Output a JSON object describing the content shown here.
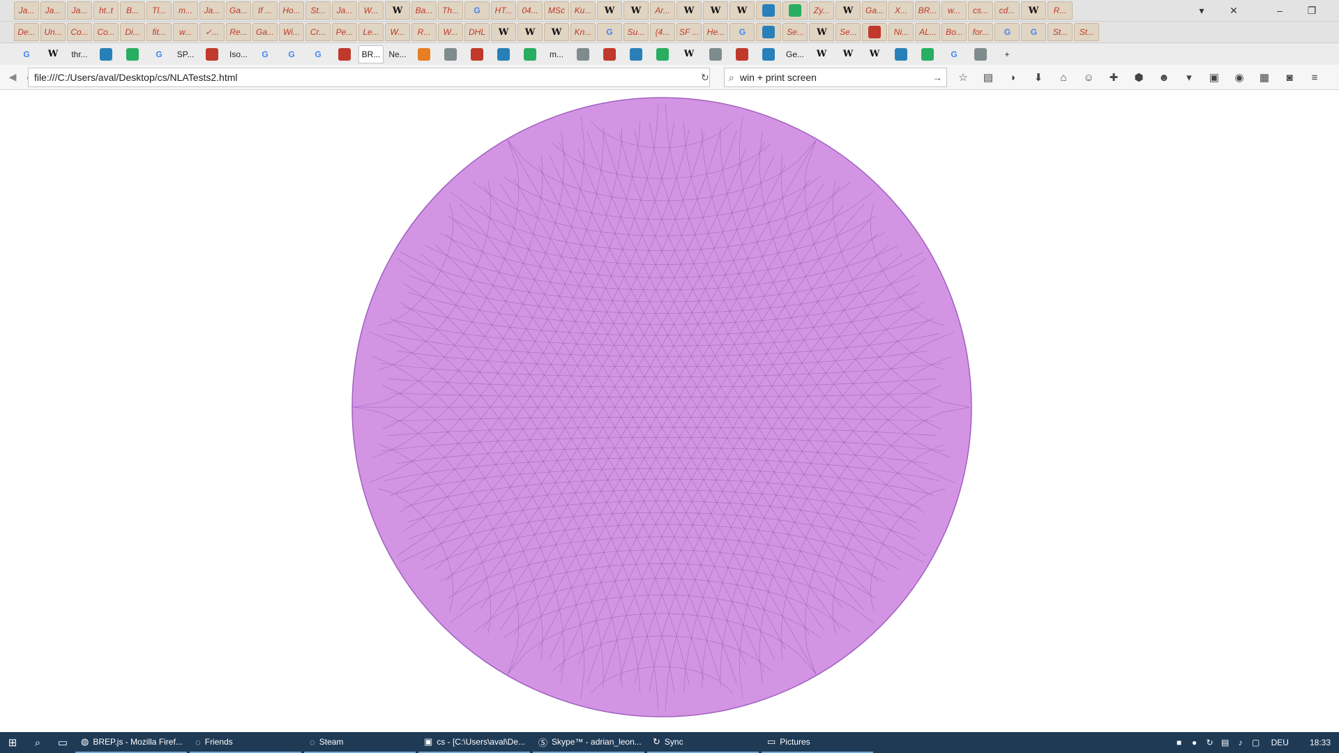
{
  "tabs_row1": [
    "Ja...",
    "Ja...",
    "Ja...",
    "ht..t",
    "B...",
    "Tl...",
    "m...",
    "Ja...",
    "Ga...",
    "If ...",
    "Ho...",
    "St...",
    "Ja...",
    "W...",
    "W",
    "Ba...",
    "Th...",
    "G",
    "HT...",
    "04...",
    "MSc",
    "Ku...",
    "W",
    "W",
    "Ar...",
    "W",
    "W",
    "W",
    "",
    "",
    "Zy...",
    "W",
    "Ga...",
    "X...",
    "BR...",
    "w...",
    "cs...",
    "cd...",
    "W",
    "R..."
  ],
  "tabs_row2": [
    "De...",
    "Un...",
    "Co...",
    "Co...",
    "Di...",
    "fit...",
    "w...",
    "✓...",
    "Re...",
    "Ga...",
    "Wi...",
    "Cr...",
    "Pe...",
    "Le...",
    "W...",
    "R...",
    "W...",
    "DHL",
    "W",
    "W",
    "W",
    "Kn...",
    "G",
    "Su...",
    "(4...",
    "SF ...",
    "He...",
    "G",
    "",
    "Se...",
    "W",
    "Se...",
    "",
    "Ni...",
    "AL...",
    "Bo...",
    "for...",
    "G",
    "G",
    "St...",
    "St..."
  ],
  "tabs_row3": [
    "G",
    "W",
    "thr...",
    "",
    "",
    "G",
    "SP...",
    "",
    "Iso...",
    "G",
    "G",
    "G",
    "",
    "BR...",
    "Ne...",
    "",
    "",
    "",
    "",
    "",
    "m...",
    "",
    "",
    "",
    "",
    "W",
    "",
    "",
    "",
    "Ge...",
    "W",
    "W",
    "W",
    "",
    "",
    "G",
    ""
  ],
  "active_tab_index": 13,
  "window_controls": {
    "min": "–",
    "restore": "❐",
    "close": "✕",
    "tablist": "▾",
    "close_tab": "✕"
  },
  "nav": {
    "url": "file:///C:/Users/aval/Desktop/cs/NLATests2.html",
    "search_value": "win + print screen"
  },
  "toolbar_icons": [
    "star-icon",
    "clipboard-icon",
    "pocket-icon",
    "download-icon",
    "home-icon",
    "chat-icon",
    "puzzle-icon",
    "abp-icon",
    "monkey-icon",
    "dropdown-icon",
    "note-icon",
    "circle-icon",
    "qr-icon",
    "camera-icon",
    "menu-icon"
  ],
  "sphere": {
    "fill": "#d395e3",
    "edge": "#a060c0"
  },
  "taskbar": {
    "apps": [
      {
        "label": "BREP.js - Mozilla Firef...",
        "icon": "firefox-icon"
      },
      {
        "label": "Friends",
        "icon": "steam-icon"
      },
      {
        "label": "Steam",
        "icon": "steam-icon"
      },
      {
        "label": "cs - [C:\\Users\\aval\\De...",
        "icon": "webstorm-icon"
      },
      {
        "label": "Skype™ - adrian_leon...",
        "icon": "skype-icon"
      },
      {
        "label": "Sync",
        "icon": "sync-icon"
      },
      {
        "label": "Pictures",
        "icon": "folder-icon"
      }
    ],
    "lang": "DEU",
    "time": "18:33"
  }
}
